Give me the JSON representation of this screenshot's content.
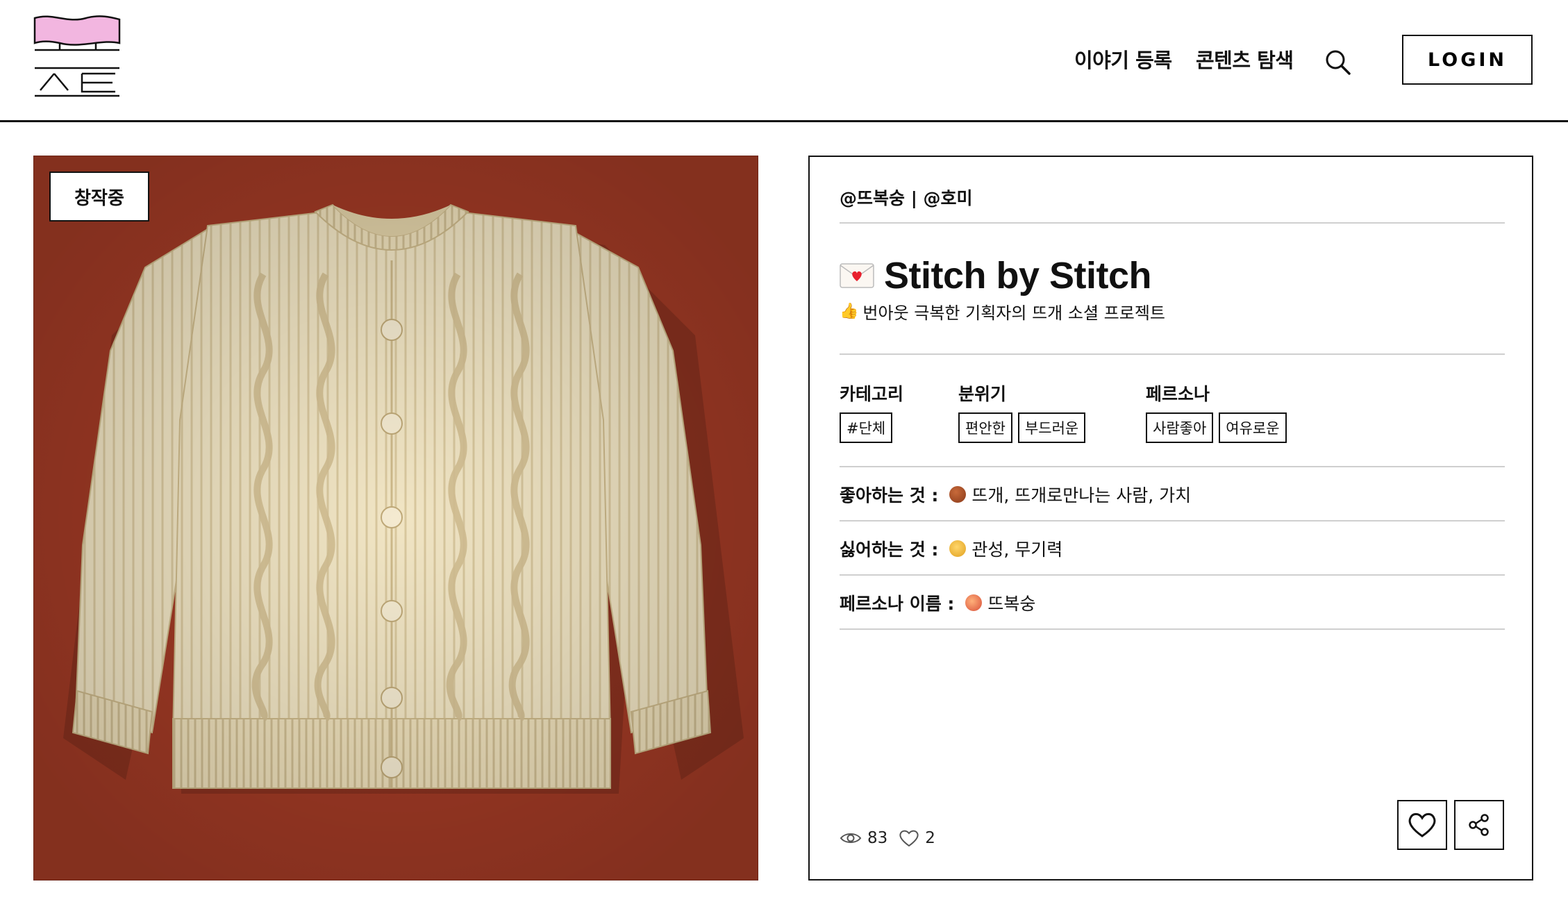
{
  "header": {
    "logo_alt": "로고",
    "nav": {
      "register": "이야기 등록",
      "browse": "콘텐츠 탐색"
    },
    "login_label": "LOGIN"
  },
  "image_panel": {
    "status_badge": "창작중",
    "background_color": "#a13a25"
  },
  "project": {
    "authors": "@뜨복숭 | @호미",
    "title_icon": "envelope-heart-icon",
    "title": "Stitch by Stitch",
    "subtitle_icon": "thumbs-up-icon",
    "subtitle": "번아웃 극복한 기획자의 뜨개 소셜 프로젝트",
    "groups": [
      {
        "label": "카테고리",
        "tags": [
          "#단체"
        ]
      },
      {
        "label": "분위기",
        "tags": [
          "편안한",
          "부드러운"
        ]
      },
      {
        "label": "페르소나",
        "tags": [
          "사람좋아",
          "여유로운"
        ]
      }
    ],
    "likes_label": "좋아하는 것 :",
    "likes_icon": "yarn-ball-icon",
    "likes_value": "뜨개, 뜨개로만나는 사람, 가치",
    "dislikes_label": "싫어하는 것 :",
    "dislikes_icon": "sad-face-icon",
    "dislikes_value": "관성, 무기력",
    "persona_label": "페르소나 이름 :",
    "persona_icon": "peach-icon",
    "persona_value": "뜨복숭",
    "views": "83",
    "likes_count": "2"
  }
}
